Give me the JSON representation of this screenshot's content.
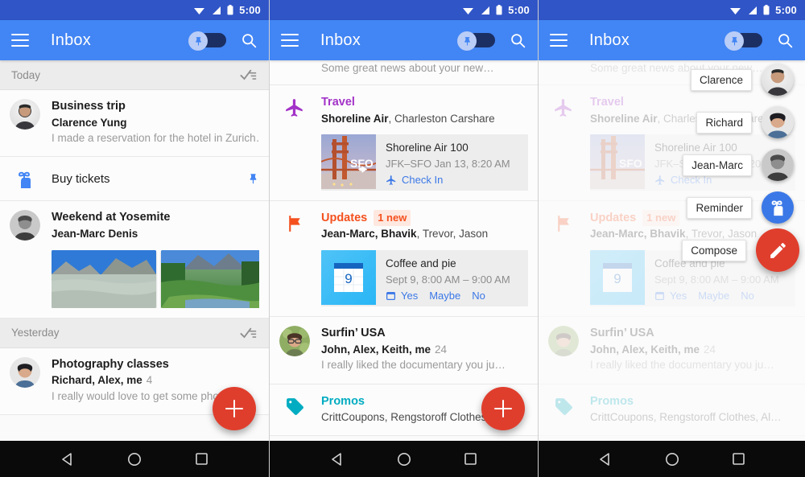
{
  "status_bar": {
    "time": "5:00",
    "icons": [
      "wifi-icon",
      "signal-icon",
      "battery-icon"
    ]
  },
  "app_bar": {
    "title": "Inbox",
    "menu_icon": "hamburger-menu-icon",
    "search_icon": "search-icon",
    "pin_toggle_icon": "pin-icon",
    "pin_toggle_state": "off"
  },
  "colors": {
    "status_bar": "#3055c7",
    "app_bar": "#4285f4",
    "fab": "#e03e2d",
    "travel_accent": "#a333c8",
    "updates_accent": "#f4511e",
    "promos_accent": "#00acc1",
    "link": "#3b78e7",
    "reminder_blue": "#3b78e7"
  },
  "panel1": {
    "sections": [
      {
        "label": "Today",
        "sweep_icon": "done-all-icon",
        "items": [
          {
            "type": "thread",
            "avatar": "avatar-clarence",
            "title": "Business trip",
            "sender": "Clarence Yung",
            "snippet": "I made a reservation for the hotel in Zurich…",
            "count": ""
          },
          {
            "type": "reminder",
            "icon": "reminder-finger-string-icon",
            "title": "Buy tickets",
            "pin_icon": "pin-icon"
          },
          {
            "type": "thread_photos",
            "avatar": "avatar-jeanmarc",
            "title": "Weekend at Yosemite",
            "sender": "Jean-Marc Denis",
            "photos": [
              "photo-tenaya-lake",
              "photo-mirror-lake",
              "photo-partial"
            ]
          }
        ]
      },
      {
        "label": "Yesterday",
        "sweep_icon": "done-all-icon",
        "items": [
          {
            "type": "thread",
            "avatar": "avatar-richard",
            "title": "Photography classes",
            "sender": "Richard, Alex, me",
            "count": "4",
            "snippet": "I really would love to get some phot…"
          }
        ]
      }
    ],
    "fab": {
      "icon": "plus-icon"
    }
  },
  "panel2": {
    "partial_top_snippet": "Some great news about your new…",
    "items": [
      {
        "type": "bundle",
        "icon": "airplane-icon",
        "bundle": "Travel",
        "accent": "#a333c8",
        "people": "Shoreline Air, Charleston Carshare",
        "people_bold": "Shoreline Air",
        "card": {
          "thumb": "sfo-golden-gate-thumb",
          "thumb_label": "SFO",
          "thumb_icon": "airplane-icon",
          "line1": "Shoreline Air 100",
          "line2": "JFK–SFO  Jan 13, 8:20 AM",
          "action_icon": "airplane-icon",
          "actions": [
            "Check In"
          ]
        }
      },
      {
        "type": "bundle",
        "icon": "flag-icon",
        "bundle": "Updates",
        "accent": "#f4511e",
        "badge": "1 new",
        "people": "Jean-Marc, Bhavik, Trevor, Jason",
        "people_bold": "Jean-Marc, Bhavik",
        "card": {
          "thumb": "calendar-icon-thumb",
          "thumb_day": "9",
          "line1": "Coffee and pie",
          "line2": "Sept 9, 8:00 AM – 9:00 AM",
          "action_icon": "calendar-icon",
          "actions": [
            "Yes",
            "Maybe",
            "No"
          ]
        }
      },
      {
        "type": "thread",
        "avatar": "avatar-surfer",
        "title": "Surfin’ USA",
        "sender": "John, Alex, Keith, me",
        "count": "24",
        "snippet": "I really liked the documentary you ju…"
      },
      {
        "type": "bundle",
        "icon": "tag-icon",
        "bundle": "Promos",
        "accent": "#00acc1",
        "people": "CrittCoupons, Rengstoroff Clothes, Al…"
      }
    ],
    "fab": {
      "icon": "plus-icon"
    }
  },
  "panel3": {
    "speed_dial": [
      {
        "label": "Clarence",
        "icon": "avatar-clarence"
      },
      {
        "label": "Richard",
        "icon": "avatar-richard"
      },
      {
        "label": "Jean-Marc",
        "icon": "avatar-jeanmarc"
      },
      {
        "label": "Reminder",
        "icon": "reminder-finger-string-icon"
      },
      {
        "label": "Compose",
        "icon": "pencil-icon"
      }
    ]
  },
  "nav_bar": {
    "back_icon": "back-triangle-icon",
    "home_icon": "home-circle-icon",
    "recents_icon": "recents-square-icon"
  }
}
